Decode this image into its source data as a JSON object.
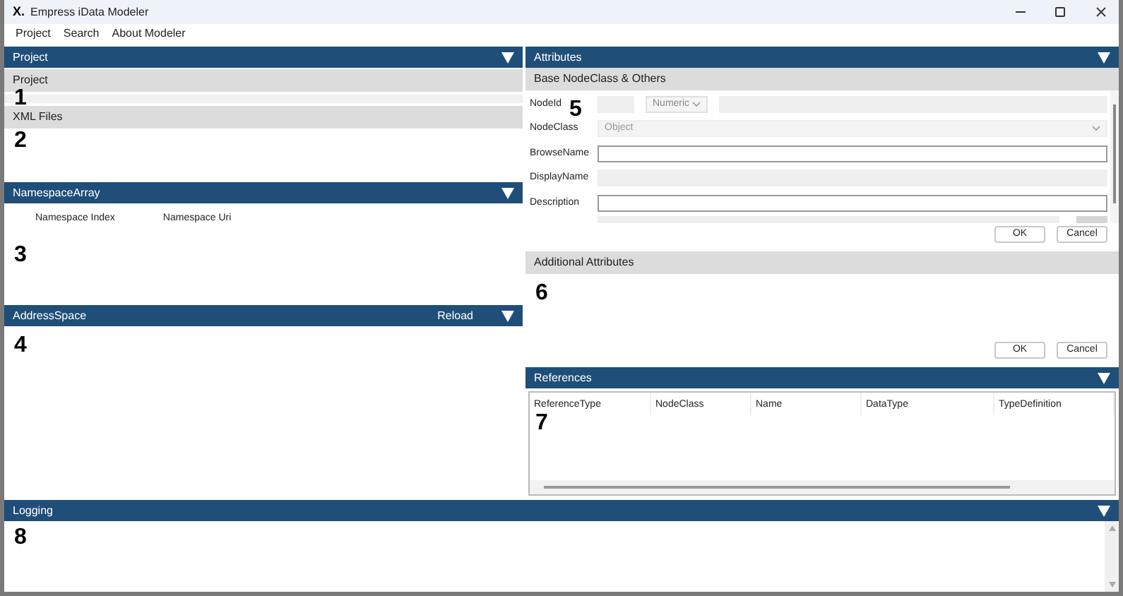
{
  "window": {
    "title": "Empress iData Modeler",
    "logo": "X."
  },
  "menu": [
    "Project",
    "Search",
    "About Modeler"
  ],
  "project_panel": {
    "title": "Project",
    "sections": [
      "Project",
      "XML Files"
    ]
  },
  "namespace_panel": {
    "title": "NamespaceArray",
    "columns": [
      "Namespace Index",
      "Namespace Uri"
    ]
  },
  "address_space_panel": {
    "title": "AddressSpace",
    "action": "Reload"
  },
  "attributes_panel": {
    "title": "Attributes",
    "section": "Base NodeClass & Others",
    "fields": [
      {
        "kind": "nodeid",
        "label": "NodeId",
        "type": "Numeric",
        "disabled": true
      },
      {
        "kind": "select",
        "label": "NodeClass",
        "value": "Object",
        "disabled": true
      },
      {
        "kind": "text",
        "label": "BrowseName",
        "disabled": false
      },
      {
        "kind": "text",
        "label": "DisplayName",
        "disabled": true
      },
      {
        "kind": "text",
        "label": "Description",
        "disabled": false
      }
    ],
    "buttons": [
      "OK",
      "Cancel"
    ],
    "additional": {
      "title": "Additional Attributes",
      "buttons": [
        "OK",
        "Cancel"
      ]
    }
  },
  "references_panel": {
    "title": "References",
    "columns": [
      "ReferenceType",
      "NodeClass",
      "Name",
      "DataType",
      "TypeDefinition"
    ]
  },
  "logging_panel": {
    "title": "Logging"
  },
  "callouts": {
    "project": "1",
    "xml_files": "2",
    "attributes": "5",
    "namespace": "3",
    "additional": "6",
    "address_space": "4",
    "references": "7",
    "logging": "8"
  }
}
